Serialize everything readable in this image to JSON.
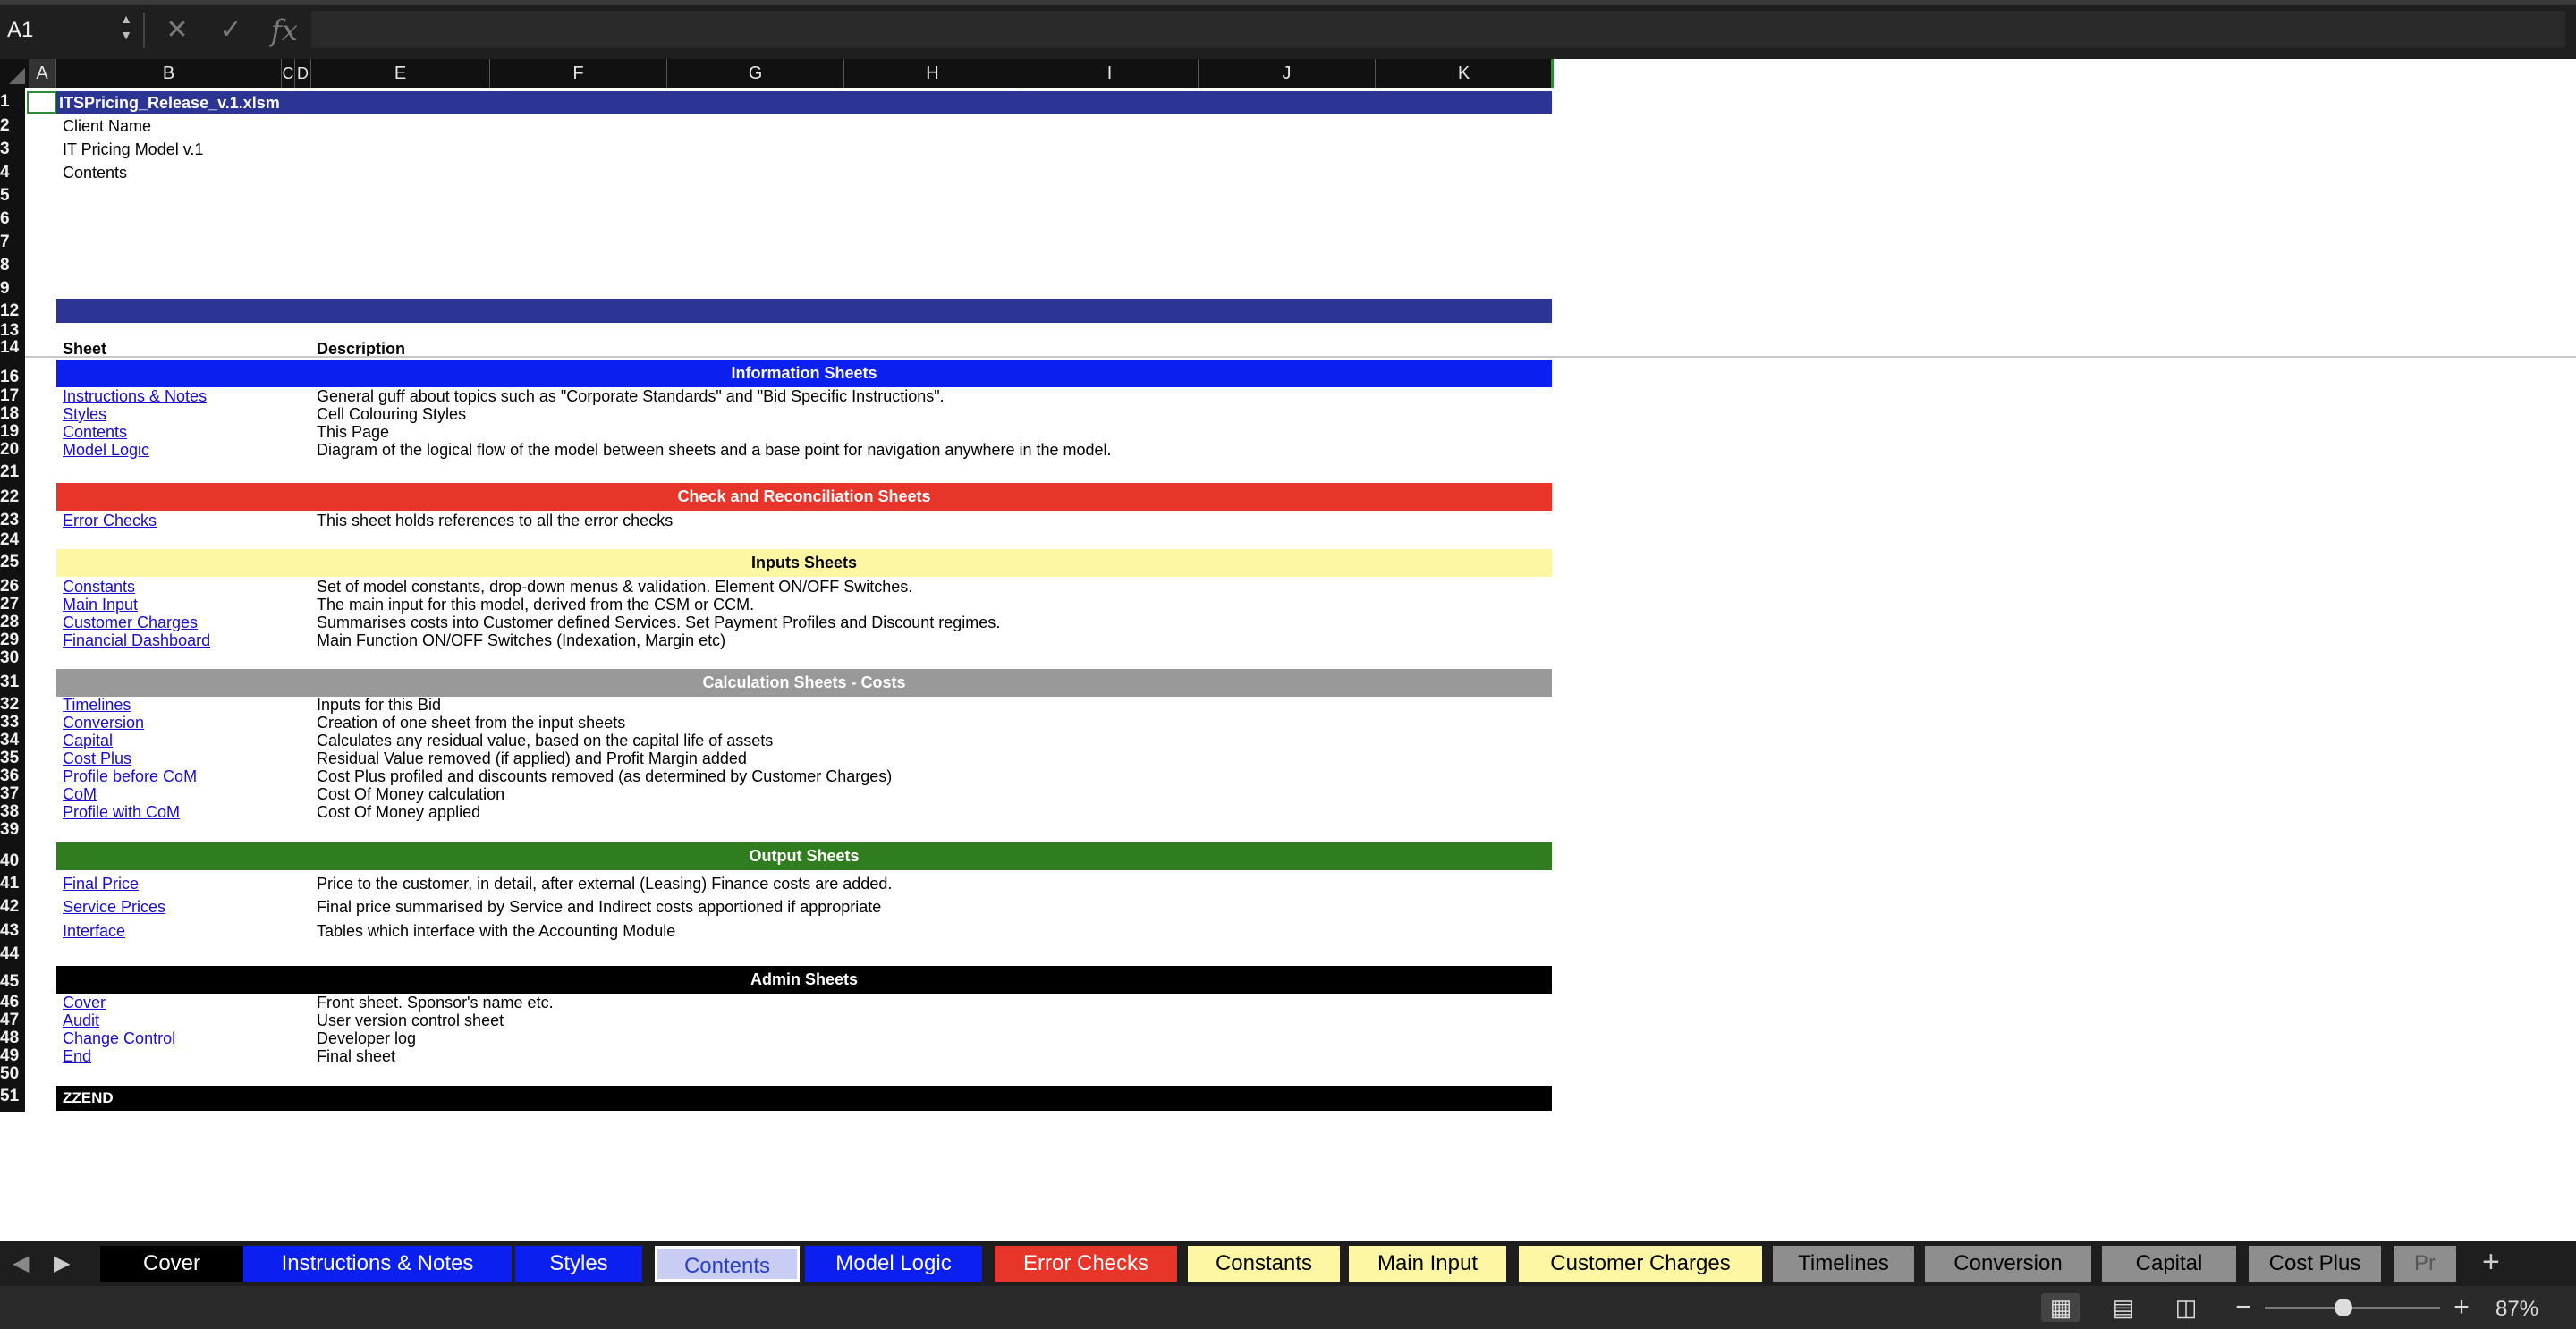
{
  "formula_bar": {
    "name_box": "A1",
    "cancel_icon": "close-icon",
    "enter_icon": "check-icon",
    "function_label": "fx",
    "formula": ""
  },
  "columns": [
    "A",
    "B",
    "C",
    "D",
    "E",
    "F",
    "G",
    "H",
    "I",
    "J",
    "K"
  ],
  "rows": [
    "1",
    "2",
    "3",
    "4",
    "5",
    "6",
    "7",
    "8",
    "9",
    "12",
    "13",
    "14",
    "16",
    "17",
    "18",
    "19",
    "20",
    "21",
    "22",
    "23",
    "24",
    "25",
    "26",
    "27",
    "28",
    "29",
    "30",
    "31",
    "32",
    "33",
    "34",
    "35",
    "36",
    "37",
    "38",
    "39",
    "40",
    "41",
    "42",
    "43",
    "44",
    "45",
    "46",
    "47",
    "48",
    "49",
    "50",
    "51"
  ],
  "sheet": {
    "file_title": "ITSPricing_Release_v.1.xlsm",
    "client_name": "Client Name",
    "model_name": "IT Pricing Model v.1",
    "page_name": "Contents",
    "col_sheet": "Sheet",
    "col_description": "Description",
    "sections": [
      {
        "title": "Information Sheets",
        "color": "#0a1ff0",
        "text_color": "#ffffff",
        "items": [
          {
            "sheet": "Instructions & Notes",
            "description": "General guff about topics such as \"Corporate Standards\" and \"Bid Specific Instructions\"."
          },
          {
            "sheet": "Styles",
            "description": "Cell Colouring Styles"
          },
          {
            "sheet": "Contents",
            "description": "This Page"
          },
          {
            "sheet": "Model Logic",
            "description": "Diagram of the logical flow of the model between sheets and a base point for navigation anywhere in the model."
          }
        ]
      },
      {
        "title": "Check and Reconciliation Sheets",
        "color": "#e8352a",
        "text_color": "#ffffff",
        "items": [
          {
            "sheet": "Error Checks",
            "description": "This sheet holds references to all the error checks"
          }
        ]
      },
      {
        "title": "Inputs Sheets",
        "color": "#fdf7a4",
        "text_color": "#000000",
        "items": [
          {
            "sheet": "Constants",
            "description": "Set of model constants, drop-down menus & validation. Element ON/OFF Switches."
          },
          {
            "sheet": "Main Input",
            "description": "The main input for this model, derived from the CSM or CCM."
          },
          {
            "sheet": "Customer Charges",
            "description": "Summarises costs into Customer defined Services. Set Payment Profiles and Discount regimes."
          },
          {
            "sheet": "Financial Dashboard",
            "description": "Main Function ON/OFF Switches (Indexation, Margin etc)"
          }
        ]
      },
      {
        "title": "Calculation Sheets - Costs",
        "color": "#999999",
        "text_color": "#ffffff",
        "items": [
          {
            "sheet": "Timelines",
            "description": "Inputs for this Bid"
          },
          {
            "sheet": "Conversion",
            "description": "Creation of one sheet from the input sheets"
          },
          {
            "sheet": "Capital",
            "description": "Calculates any residual value, based on the capital life of assets"
          },
          {
            "sheet": "Cost Plus",
            "description": "Residual Value removed (if applied) and Profit Margin added"
          },
          {
            "sheet": "Profile before CoM",
            "description": "Cost Plus profiled and discounts removed (as determined by Customer Charges)"
          },
          {
            "sheet": "CoM",
            "description": "Cost Of Money calculation"
          },
          {
            "sheet": "Profile with CoM",
            "description": "Cost Of Money applied"
          }
        ]
      },
      {
        "title": "Output Sheets",
        "color": "#2f7d1e",
        "text_color": "#ffffff",
        "items": [
          {
            "sheet": "Final Price",
            "description": "Price to the customer, in detail, after external (Leasing) Finance costs are added."
          },
          {
            "sheet": "Service Prices",
            "description": "Final price summarised by Service and Indirect costs apportioned if appropriate"
          },
          {
            "sheet": "Interface",
            "description": "Tables which interface with the Accounting Module"
          }
        ]
      },
      {
        "title": "Admin Sheets",
        "color": "#000000",
        "text_color": "#ffffff",
        "items": [
          {
            "sheet": "Cover",
            "description": "Front sheet. Sponsor's name etc."
          },
          {
            "sheet": "Audit",
            "description": "User version control sheet"
          },
          {
            "sheet": "Change Control",
            "description": "Developer log"
          },
          {
            "sheet": "End",
            "description": "Final sheet"
          }
        ]
      }
    ],
    "end_marker": "ZZEND"
  },
  "tabs": [
    {
      "label": "Cover",
      "bg": "#000000",
      "fg": "#ffffff"
    },
    {
      "label": "Instructions & Notes",
      "bg": "#0a1ff0",
      "fg": "#ffffff"
    },
    {
      "label": "Styles",
      "bg": "#0a1ff0",
      "fg": "#ffffff"
    },
    {
      "label": "Contents",
      "bg": "#c9cdf4",
      "fg": "#2840c8",
      "active": true
    },
    {
      "label": "Model Logic",
      "bg": "#0a1ff0",
      "fg": "#ffffff"
    },
    {
      "label": "Error Checks",
      "bg": "#e8352a",
      "fg": "#ffffff"
    },
    {
      "label": "Constants",
      "bg": "#fdf7a4",
      "fg": "#000000"
    },
    {
      "label": "Main Input",
      "bg": "#fdf7a4",
      "fg": "#000000"
    },
    {
      "label": "Customer Charges",
      "bg": "#fdf7a4",
      "fg": "#000000"
    },
    {
      "label": "Timelines",
      "bg": "#8e8e8e",
      "fg": "#000000"
    },
    {
      "label": "Conversion",
      "bg": "#8e8e8e",
      "fg": "#000000"
    },
    {
      "label": "Capital",
      "bg": "#8e8e8e",
      "fg": "#000000"
    },
    {
      "label": "Cost Plus",
      "bg": "#8e8e8e",
      "fg": "#000000"
    },
    {
      "label": "Pr",
      "bg": "#8e8e8e",
      "fg": "#555555"
    }
  ],
  "status_bar": {
    "zoom_level": "87%",
    "zoom_fraction": 0.45
  }
}
